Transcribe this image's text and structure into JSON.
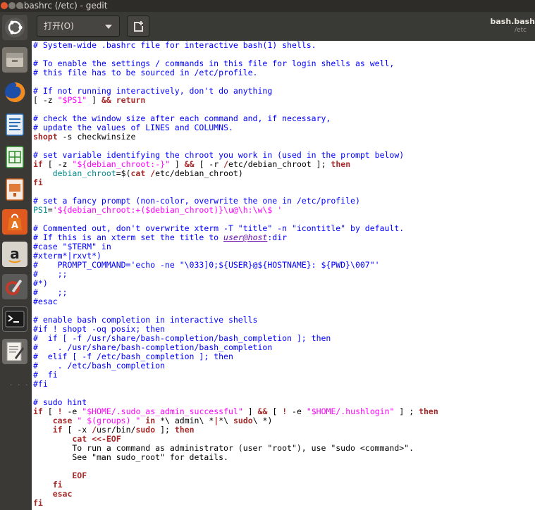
{
  "window": {
    "title": "bashrc (/etc) - gedit",
    "title_display": ".bashrc (/etc) - gedit"
  },
  "header": {
    "open_label": "打开(O)",
    "doc_name": "bash.bash",
    "doc_path": "/etc"
  },
  "launcher": {
    "items": [
      "ubuntu-dash",
      "files",
      "firefox",
      "writer",
      "calc",
      "impress",
      "software-center",
      "amazon",
      "system-settings",
      "terminal",
      "text-editor"
    ]
  },
  "colors": {
    "comment": "#0000ff",
    "keyword": "#a52a2a",
    "string": "#ff00ff",
    "variable": "#008a8c"
  },
  "editor": {
    "lines": [
      [
        [
          "c",
          "# System-wide .bashrc file for interactive bash(1) shells."
        ]
      ],
      [],
      [
        [
          "c",
          "# To enable the settings / commands in this file for login shells as well,"
        ]
      ],
      [
        [
          "c",
          "# this file has to be sourced in /etc/profile."
        ]
      ],
      [],
      [
        [
          "c",
          "# If not running interactively, don't do anything"
        ]
      ],
      [
        [
          "o",
          "[ -z "
        ],
        [
          "s",
          "\"$PS1\""
        ],
        [
          "o",
          " ] "
        ],
        [
          "k",
          "&&"
        ],
        [
          "o",
          " "
        ],
        [
          "k",
          "return"
        ]
      ],
      [],
      [
        [
          "c",
          "# check the window size after each command and, if necessary,"
        ]
      ],
      [
        [
          "c",
          "# update the values of LINES and COLUMNS."
        ]
      ],
      [
        [
          "k",
          "shopt"
        ],
        [
          "o",
          " -s checkwinsize"
        ]
      ],
      [],
      [
        [
          "c",
          "# set variable identifying the chroot you work in (used in the prompt below)"
        ]
      ],
      [
        [
          "k",
          "if"
        ],
        [
          "o",
          " [ -z "
        ],
        [
          "s",
          "\"${debian_chroot:-}\""
        ],
        [
          "o",
          " ] "
        ],
        [
          "k",
          "&&"
        ],
        [
          "o",
          " [ -r "
        ],
        [
          "k",
          "/"
        ],
        [
          "o",
          "etc/debian_chroot ]; "
        ],
        [
          "k",
          "then"
        ]
      ],
      [
        [
          "o",
          "    "
        ],
        [
          "v",
          "debian_chroot"
        ],
        [
          "o",
          "=$("
        ],
        [
          "k",
          "cat"
        ],
        [
          "o",
          " "
        ],
        [
          "k",
          "/"
        ],
        [
          "o",
          "etc/debian_chroot)"
        ]
      ],
      [
        [
          "k",
          "fi"
        ]
      ],
      [],
      [
        [
          "c",
          "# set a fancy prompt (non-color, overwrite the one in /etc/profile)"
        ]
      ],
      [
        [
          "v",
          "PS1"
        ],
        [
          "o",
          "="
        ],
        [
          "s",
          "'${debian_chroot:+($debian_chroot)}\\u@\\h:\\w\\$ '"
        ]
      ],
      [],
      [
        [
          "c",
          "# Commented out, don't overwrite xterm -T \"title\" -n \"icontitle\" by default."
        ]
      ],
      [
        [
          "c",
          "# If this is an xterm set the title to "
        ],
        [
          "u",
          "user@host"
        ],
        [
          "c",
          ":dir"
        ]
      ],
      [
        [
          "c",
          "#case \"$TERM\" in"
        ]
      ],
      [
        [
          "c",
          "#xterm*|rxvt*)"
        ]
      ],
      [
        [
          "c",
          "#    PROMPT_COMMAND='echo -ne \"\\033]0;${USER}@${HOSTNAME}: ${PWD}\\007\"'"
        ]
      ],
      [
        [
          "c",
          "#    ;;"
        ]
      ],
      [
        [
          "c",
          "#*)"
        ]
      ],
      [
        [
          "c",
          "#    ;;"
        ]
      ],
      [
        [
          "c",
          "#esac"
        ]
      ],
      [],
      [
        [
          "c",
          "# enable bash completion in interactive shells"
        ]
      ],
      [
        [
          "c",
          "#if ! shopt -oq posix; then"
        ]
      ],
      [
        [
          "c",
          "#  if [ -f /usr/share/bash-completion/bash_completion ]; then"
        ]
      ],
      [
        [
          "c",
          "#    . /usr/share/bash-completion/bash_completion"
        ]
      ],
      [
        [
          "c",
          "#  elif [ -f /etc/bash_completion ]; then"
        ]
      ],
      [
        [
          "c",
          "#    . /etc/bash_completion"
        ]
      ],
      [
        [
          "c",
          "#  fi"
        ]
      ],
      [
        [
          "c",
          "#fi"
        ]
      ],
      [],
      [
        [
          "c",
          "# sudo hint"
        ]
      ],
      [
        [
          "k",
          "if"
        ],
        [
          "o",
          " [ "
        ],
        [
          "k",
          "!"
        ],
        [
          "o",
          " -e "
        ],
        [
          "s",
          "\"$HOME/.sudo_as_admin_successful\""
        ],
        [
          "o",
          " ] "
        ],
        [
          "k",
          "&&"
        ],
        [
          "o",
          " [ "
        ],
        [
          "k",
          "!"
        ],
        [
          "o",
          " -e "
        ],
        [
          "s",
          "\"$HOME/.hushlogin\""
        ],
        [
          "o",
          " ] ; "
        ],
        [
          "k",
          "then"
        ]
      ],
      [
        [
          "o",
          "    "
        ],
        [
          "k",
          "case"
        ],
        [
          "o",
          " "
        ],
        [
          "s",
          "\" $(groups) \""
        ],
        [
          "o",
          " "
        ],
        [
          "k",
          "in"
        ],
        [
          "o",
          " *\\ admin\\ *"
        ],
        [
          "k",
          "|"
        ],
        [
          "o",
          "*\\ "
        ],
        [
          "k",
          "sudo"
        ],
        [
          "o",
          "\\ *)"
        ]
      ],
      [
        [
          "o",
          "    "
        ],
        [
          "k",
          "if"
        ],
        [
          "o",
          " [ -x "
        ],
        [
          "k",
          "/"
        ],
        [
          "o",
          "usr/bin/"
        ],
        [
          "k",
          "sudo"
        ],
        [
          "o",
          " ]; "
        ],
        [
          "k",
          "then"
        ]
      ],
      [
        [
          "o",
          "        "
        ],
        [
          "k",
          "cat"
        ],
        [
          "o",
          " "
        ],
        [
          "k",
          "<<-EOF"
        ]
      ],
      [
        [
          "o",
          "        To run a command as administrator (user \"root\"), use \"sudo <command>\"."
        ]
      ],
      [
        [
          "o",
          "        See \"man sudo_root\" for details."
        ]
      ],
      [],
      [
        [
          "k",
          "        EOF"
        ]
      ],
      [
        [
          "o",
          "    "
        ],
        [
          "k",
          "fi"
        ]
      ],
      [
        [
          "o",
          "    "
        ],
        [
          "k",
          "esac"
        ]
      ],
      [
        [
          "k",
          "fi"
        ]
      ]
    ]
  }
}
